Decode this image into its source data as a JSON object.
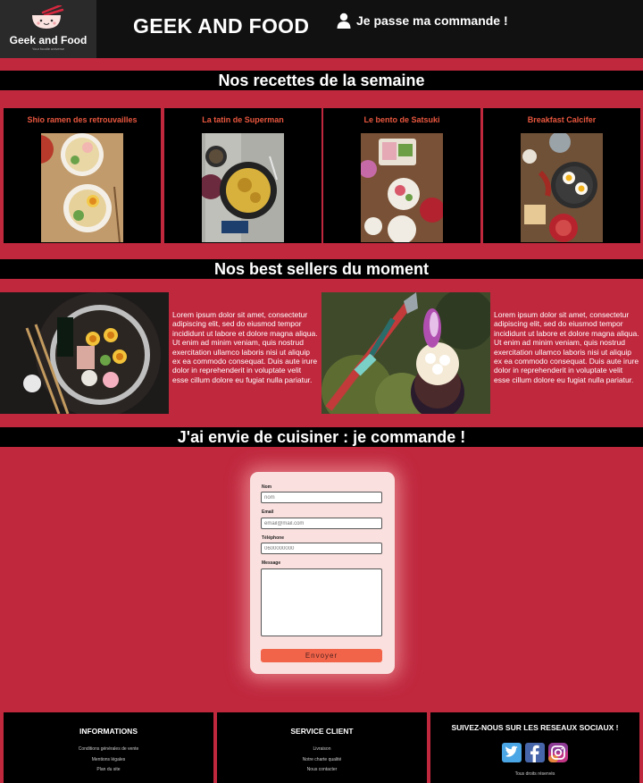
{
  "header": {
    "logo_name": "Geek and Food",
    "logo_tagline": "Your foodie universe",
    "site_title": "GEEK AND FOOD",
    "order_link": "Je passe ma commande !"
  },
  "recipes": {
    "heading": "Nos recettes de la semaine",
    "items": [
      {
        "title": "Shio ramen des retrouvailles"
      },
      {
        "title": "La tatin de Superman"
      },
      {
        "title": "Le bento de Satsuki"
      },
      {
        "title": "Breakfast Calcifer"
      }
    ]
  },
  "bestsellers": {
    "heading": "Nos best sellers du moment",
    "items": [
      {
        "text": "Lorem ipsum dolor sit amet, consectetur adipiscing elit, sed do eiusmod tempor incididunt ut labore et dolore magna aliqua. Ut enim ad minim veniam, quis nostrud exercitation ullamco laboris nisi ut aliquip ex ea commodo consequat. Duis aute irure dolor in reprehenderit in voluptate velit esse cillum dolore eu fugiat nulla pariatur."
      },
      {
        "text": "Lorem ipsum dolor sit amet, consectetur adipiscing elit, sed do eiusmod tempor incididunt ut labore et dolore magna aliqua. Ut enim ad minim veniam, quis nostrud exercitation ullamco laboris nisi ut aliquip ex ea commodo consequat. Duis aute irure dolor in reprehenderit in voluptate velit esse cillum dolore eu fugiat nulla pariatur."
      }
    ]
  },
  "order": {
    "heading": "J'ai envie de cuisiner : je commande !",
    "form": {
      "name_label": "Nom",
      "name_placeholder": "nom",
      "email_label": "Email",
      "email_placeholder": "email@mail.com",
      "phone_label": "Téléphone",
      "phone_placeholder": "0600000000",
      "message_label": "Message",
      "submit_label": "Envoyer"
    }
  },
  "footer": {
    "info": {
      "heading": "INFORMATIONS",
      "links": [
        "Conditions générales de vente",
        "Mentions légales",
        "Plan du site"
      ]
    },
    "service": {
      "heading": "SERVICE CLIENT",
      "links": [
        "Livraison",
        "Notre charte qualité",
        "Nous contacter"
      ]
    },
    "social": {
      "heading": "SUIVEZ-NOUS SUR LES RESEAUX SOCIAUX !",
      "icons": [
        "twitter-icon",
        "facebook-icon",
        "instagram-icon"
      ],
      "rights": "Tous droits réservés"
    }
  },
  "colors": {
    "background": "#c0283e",
    "bar": "#000000",
    "accent": "#e9573f",
    "button": "#f26449",
    "form_bg": "#fae0de"
  }
}
